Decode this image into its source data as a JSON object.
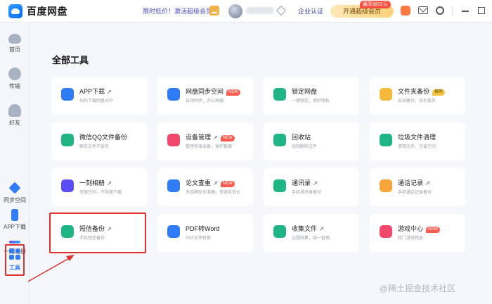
{
  "app": {
    "title": "百度网盘"
  },
  "header": {
    "promo": "限时低价！激活超级会员",
    "enterprise": "企业认证",
    "vip_button": "开通超级会员",
    "vip_badge": "最高省62元"
  },
  "sidebar": {
    "items": [
      {
        "label": "首页",
        "icon": "cloud-icon"
      },
      {
        "label": "传输",
        "icon": "transfer-icon"
      },
      {
        "label": "好友",
        "icon": "friends-icon"
      },
      {
        "label": "同步空间",
        "icon": "sync-icon"
      },
      {
        "label": "APP下载",
        "icon": "phone-icon"
      },
      {
        "label": "一刻相册",
        "icon": "album-icon"
      }
    ],
    "active": {
      "label": "工具",
      "icon": "tools-icon"
    }
  },
  "main": {
    "section_title": "全部工具",
    "tools": [
      {
        "title": "APP下载",
        "arrow": "↗",
        "badge": "",
        "sub": "扫码下载网盘APP",
        "color": "#2f7cf6"
      },
      {
        "title": "网盘同步空间",
        "arrow": "",
        "badge": "NEW",
        "sub": "自动同步，办公神器",
        "color": "#2f7cf6"
      },
      {
        "title": "锁定网盘",
        "arrow": "",
        "badge": "",
        "sub": "一键锁定，保护隐私",
        "color": "#20b584"
      },
      {
        "title": "文件夹备份",
        "arrow": "",
        "badge": "推荐",
        "sub": "自动备份，告别丢失",
        "color": "#f6b93b"
      },
      {
        "title": "微信QQ文件备份",
        "arrow": "",
        "badge": "",
        "sub": "聊天文件不丢失",
        "color": "#20b584"
      },
      {
        "title": "设备管理",
        "arrow": "↗",
        "badge": "NEW",
        "sub": "管理登录设备，保护数据",
        "color": "#f0476b"
      },
      {
        "title": "回收站",
        "arrow": "",
        "badge": "",
        "sub": "找回删除文件",
        "color": "#20b584"
      },
      {
        "title": "垃圾文件清理",
        "arrow": "",
        "badge": "",
        "sub": "清理文件，节省空间",
        "color": "#20b584"
      },
      {
        "title": "一刻相册",
        "arrow": "↗",
        "badge": "",
        "sub": "无限空间，不限速下载",
        "color": "#5b4df5"
      },
      {
        "title": "论文查重",
        "arrow": "↗",
        "badge": "NEW",
        "sub": "多品牌安全准确，快速且低价",
        "color": "#2f7cf6"
      },
      {
        "title": "通讯录",
        "arrow": "↗",
        "badge": "",
        "sub": "手机通讯录备份",
        "color": "#20b584"
      },
      {
        "title": "通话记录",
        "arrow": "↗",
        "badge": "",
        "sub": "手机通话记录备份",
        "color": "#f6a53b"
      },
      {
        "title": "短信备份",
        "arrow": "↗",
        "badge": "",
        "sub": "手机短信备份",
        "color": "#20b584"
      },
      {
        "title": "PDF转Word",
        "arrow": "",
        "badge": "",
        "sub": "PDF文件转换",
        "color": "#2f7cf6"
      },
      {
        "title": "收集文件",
        "arrow": "↗",
        "badge": "",
        "sub": "远程收集，统一管理",
        "color": "#20b584"
      },
      {
        "title": "游戏中心",
        "arrow": "",
        "badge": "NEW",
        "sub": "热门游戏精选",
        "color": "#f0476b"
      }
    ]
  },
  "watermark": "@稀土掘金技术社区"
}
